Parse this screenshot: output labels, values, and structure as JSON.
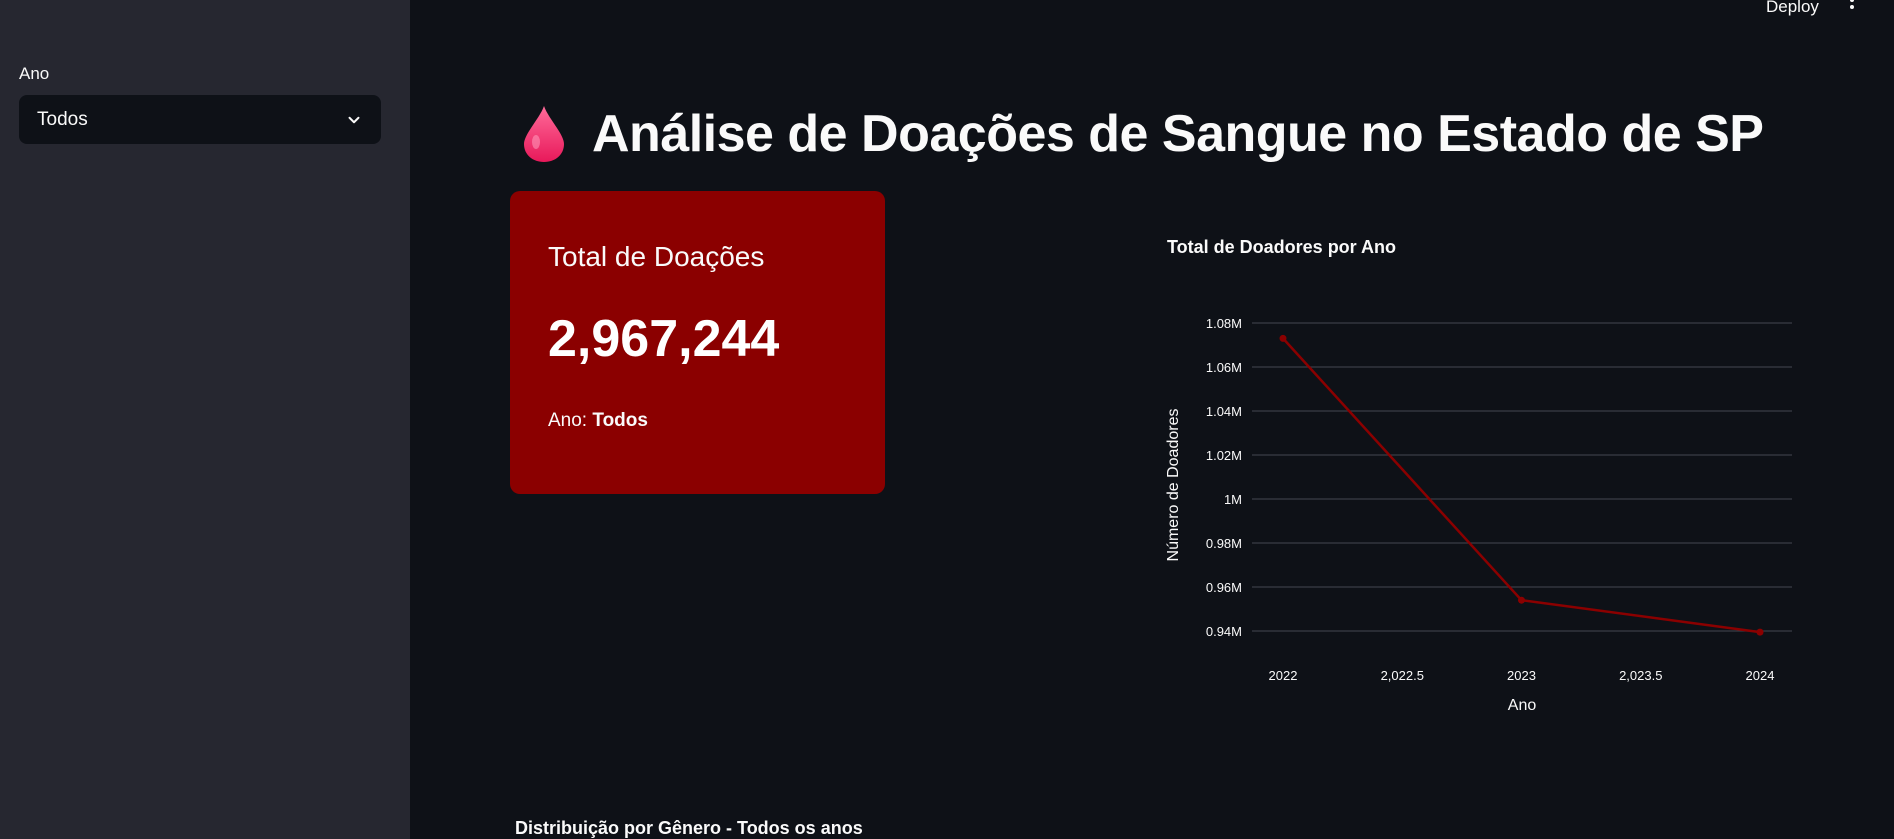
{
  "sidebar": {
    "filter_label": "Ano",
    "filter_value": "Todos"
  },
  "toolbar": {
    "deploy_label": "Deploy",
    "menu_icon": "vertical-dots-icon"
  },
  "header": {
    "icon": "blood-drop-icon",
    "title": "Análise de Doações de Sangue no Estado de SP"
  },
  "metric_card": {
    "title": "Total de Doações",
    "value": "2,967,244",
    "sub_label": "Ano:",
    "sub_value": "Todos",
    "background": "#8b0000"
  },
  "chart_data": {
    "type": "line",
    "title": "Total de Doadores por Ano",
    "xlabel": "Ano",
    "ylabel": "Número de Doadores",
    "x": [
      2022,
      2023,
      2024
    ],
    "y": [
      1073000,
      954000,
      939500
    ],
    "x_ticks": [
      "2022",
      "2,022.5",
      "2023",
      "2,023.5",
      "2024"
    ],
    "y_ticks": [
      "0.94M",
      "0.96M",
      "0.98M",
      "1M",
      "1.02M",
      "1.04M",
      "1.06M",
      "1.08M"
    ],
    "xlim": [
      2022,
      2024
    ],
    "ylim": [
      0.94,
      1.08
    ],
    "grid": true,
    "color": "#8b0000"
  },
  "next_section": {
    "title": "Distribuição por Gênero - Todos os anos"
  }
}
